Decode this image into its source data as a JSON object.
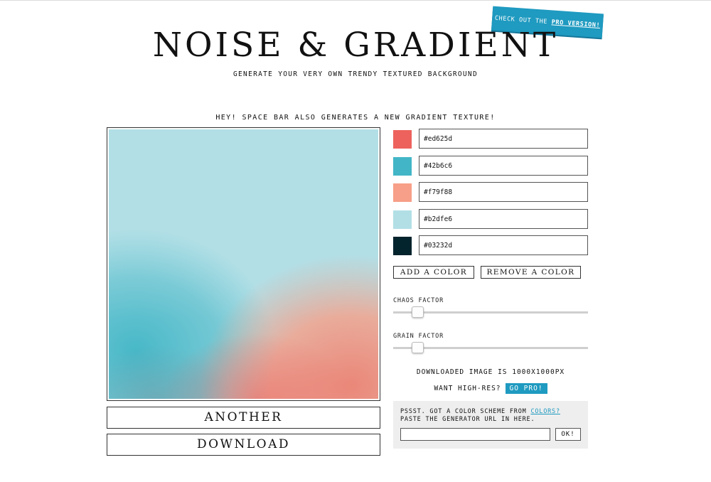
{
  "banner": {
    "prefix": "CHECK OUT THE ",
    "link": "PRO VERSION!"
  },
  "header": {
    "title": "NOISE & GRADIENT",
    "subtitle": "GENERATE YOUR VERY OWN TRENDY TEXTURED BACKGROUND"
  },
  "hint": "HEY! SPACE BAR ALSO GENERATES A NEW GRADIENT TEXTURE!",
  "colors": [
    {
      "hex": "#ed625d"
    },
    {
      "hex": "#42b6c6"
    },
    {
      "hex": "#f79f88"
    },
    {
      "hex": "#b2dfe6"
    },
    {
      "hex": "#03232d"
    }
  ],
  "buttons": {
    "add_color": "ADD A COLOR",
    "remove_color": "REMOVE A COLOR",
    "another": "ANOTHER",
    "download": "DOWNLOAD"
  },
  "sliders": {
    "chaos": {
      "label": "CHAOS FACTOR",
      "value_fraction": 0.1
    },
    "grain": {
      "label": "GRAIN FACTOR",
      "value_fraction": 0.1
    }
  },
  "info": {
    "download_size": "DOWNLOADED IMAGE IS 1000X1000PX",
    "high_res": "WANT HIGH-RES?",
    "go_pro": "GO PRO!"
  },
  "coolors": {
    "line1_prefix": "PSSST. GOT A COLOR SCHEME FROM ",
    "link": "COLORS?",
    "line2": "PASTE THE GENERATOR URL IN HERE.",
    "input_value": "",
    "ok": "OK!"
  },
  "theme": {
    "accent": "#1f9ac0"
  }
}
